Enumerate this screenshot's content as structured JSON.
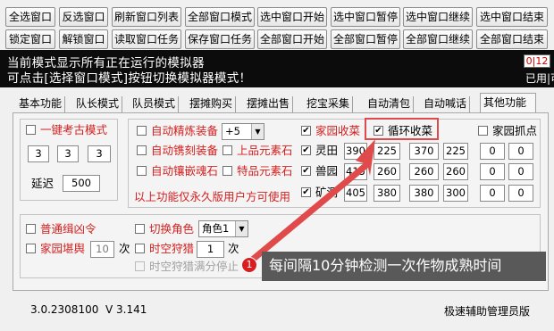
{
  "toolbar": {
    "row1": [
      "全选窗口",
      "反选窗口",
      "刷新窗口列表",
      "全部窗口模式",
      "选中窗口开始",
      "选中窗口暂停",
      "选中窗口继续",
      "选中窗口结束"
    ],
    "row2": [
      "锁定窗口",
      "解锁窗口",
      "读取窗口任务",
      "保存窗口任务",
      "全部窗口开始",
      "全部窗口暂停",
      "全部窗口继续",
      "全部窗口结束"
    ]
  },
  "banner": {
    "line1": "当前模式显示所有正在运行的模拟器",
    "line2": "可点击[选择窗口模式]按钮切换模拟器模式！",
    "counter_used": "0",
    "counter_total": "12",
    "used_label": "已用|可用"
  },
  "tabs": [
    "基本功能",
    "队长模式",
    "队员模式",
    "摆摊购买",
    "摆摊出售",
    "挖宝采集",
    "自动清包",
    "自动喊话",
    "其他功能"
  ],
  "active_tab": "其他功能",
  "kaogu": {
    "label": "一键考古模式",
    "checked": false,
    "values": [
      "3",
      "3",
      "3"
    ],
    "delay_label": "延迟",
    "delay_value": "500"
  },
  "equip": {
    "jinglian_label": "自动精炼装备",
    "jinglian_level": "+5",
    "juanke_label": "自动镌刻装备",
    "shangpin_label": "上品元素石",
    "xiangqian_label": "自动镶嵌魂石",
    "tepin_label": "特品元素石",
    "notice": "以上功能仅永久版用户方可使用"
  },
  "garden": {
    "shouhuo_label": "家园收菜",
    "shouhuo_checked": true,
    "xunhuan_label": "循环收菜",
    "xunhuan_checked": true,
    "zhuabu_label": "家园抓点",
    "zhuabu_checked": false,
    "rows": [
      {
        "label": "灵田",
        "checked": true,
        "values": [
          "390",
          "225",
          "370",
          "225"
        ],
        "extra": [
          "0",
          "0"
        ]
      },
      {
        "label": "兽园",
        "checked": true,
        "values": [
          "415",
          "260",
          "260",
          "260"
        ],
        "extra": [
          "0",
          "0"
        ]
      },
      {
        "label": "矿洞",
        "checked": true,
        "values": [
          "405",
          "380",
          "380",
          "300"
        ],
        "extra": [
          "0",
          "0"
        ]
      }
    ]
  },
  "misc": {
    "putong_label": "普通缉凶令",
    "qiehuan_label": "切换角色",
    "role_value": "角色1",
    "kanyu_label": "家园堪舆",
    "kanyu_count": "10",
    "ci1": "次",
    "shikong_label": "时空狩猎",
    "shikong_count": "1",
    "ci2": "次",
    "shikong_full_label": "时空狩猎满分停止"
  },
  "tooltip": {
    "badge": "1",
    "text": "每间隔10分钟检测一次作物成熟时间"
  },
  "footer": {
    "version_left": "3.0.2308100",
    "version_right": "V 3.141",
    "edition": "极速辅助管理员版"
  },
  "colors": {
    "accent_red": "#d42020",
    "highlight_border": "#e04a4a",
    "banner_bg": "#0c0c0c",
    "tooltip_bg": "#595959"
  }
}
